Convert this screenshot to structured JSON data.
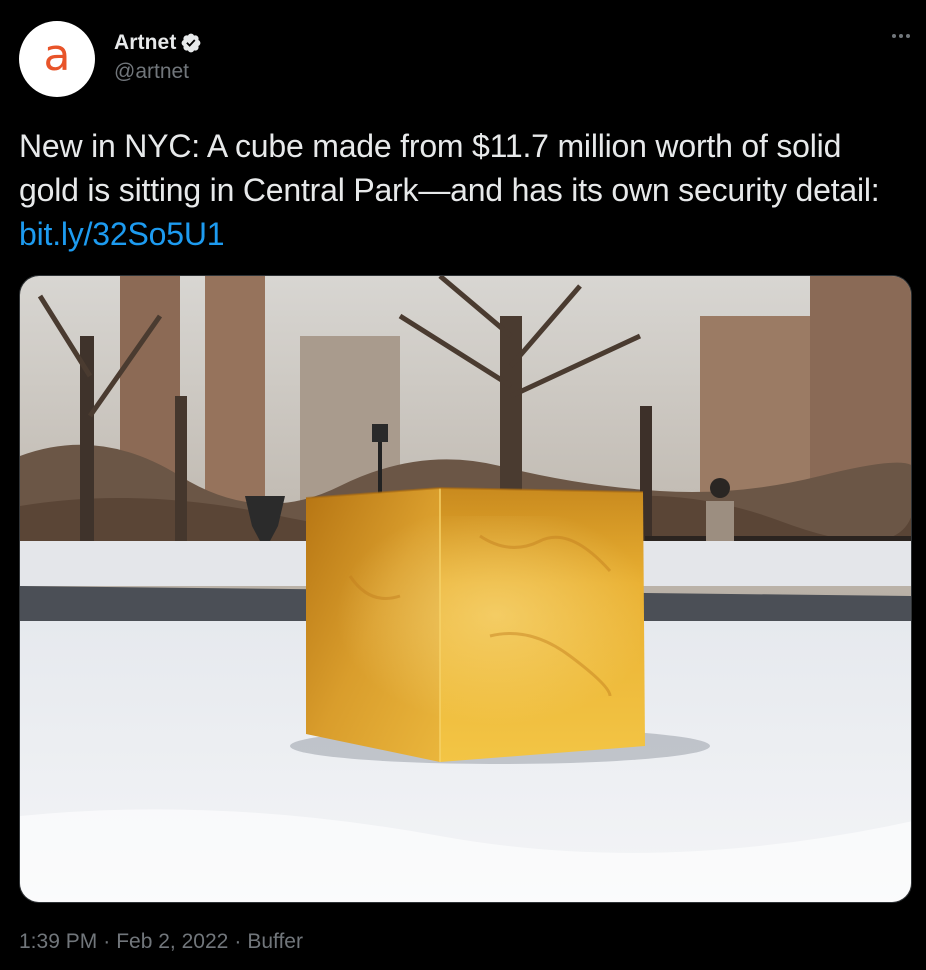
{
  "author": {
    "avatar_letter": "a",
    "display_name": "Artnet",
    "handle": "@artnet",
    "verified": true
  },
  "tweet": {
    "text": "New in NYC: A cube made from $11.7 million worth of solid gold is sitting in Central Park—and has its own security detail: ",
    "link_text": "bit.ly/32So5U1"
  },
  "meta": {
    "time": "1:39 PM",
    "separator": "·",
    "date": "Feb 2, 2022",
    "source": "Buffer"
  },
  "colors": {
    "background": "#000000",
    "text": "#e7e9ea",
    "secondary_text": "#71767b",
    "link": "#1d9bf0",
    "avatar_letter": "#e8542a"
  },
  "icons": {
    "verified": "verified-badge-icon",
    "more": "more-options-icon"
  }
}
